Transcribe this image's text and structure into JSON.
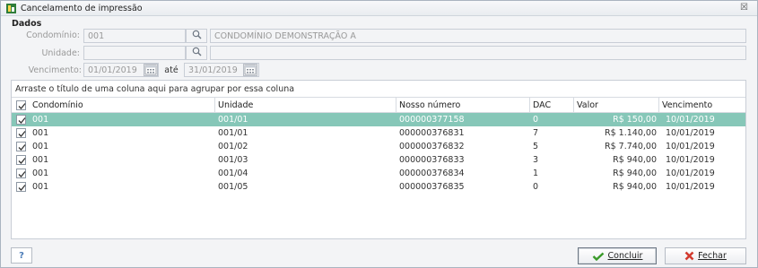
{
  "window": {
    "title": "Cancelamento de impressão",
    "close": "☒"
  },
  "dados": {
    "group_title": "Dados",
    "condominio_label": "Condomínio:",
    "condominio_code": "001",
    "condominio_name": "CONDOMÍNIO DEMONSTRAÇÃO A",
    "unidade_label": "Unidade:",
    "unidade_code": "",
    "unidade_name": "",
    "vencimento_label": "Vencimento:",
    "vencimento_from": "01/01/2019",
    "ate_label": "até",
    "vencimento_to": "31/01/2019"
  },
  "grid": {
    "group_hint": "Arraste o título de uma coluna aqui para agrupar por essa coluna",
    "columns": [
      "Condomínio",
      "Unidade",
      "Nosso número",
      "DAC",
      "Valor",
      "Vencimento"
    ],
    "rows": [
      {
        "checked": true,
        "condominio": "001",
        "unidade": "001/01",
        "nosso_numero": "000000377158",
        "dac": "0",
        "valor": "R$ 150,00",
        "vencimento": "10/01/2019"
      },
      {
        "checked": true,
        "condominio": "001",
        "unidade": "001/01",
        "nosso_numero": "000000376831",
        "dac": "7",
        "valor": "R$ 1.140,00",
        "vencimento": "10/01/2019"
      },
      {
        "checked": true,
        "condominio": "001",
        "unidade": "001/02",
        "nosso_numero": "000000376832",
        "dac": "5",
        "valor": "R$ 7.740,00",
        "vencimento": "10/01/2019"
      },
      {
        "checked": true,
        "condominio": "001",
        "unidade": "001/03",
        "nosso_numero": "000000376833",
        "dac": "3",
        "valor": "R$ 940,00",
        "vencimento": "10/01/2019"
      },
      {
        "checked": true,
        "condominio": "001",
        "unidade": "001/04",
        "nosso_numero": "000000376834",
        "dac": "1",
        "valor": "R$ 940,00",
        "vencimento": "10/01/2019"
      },
      {
        "checked": true,
        "condominio": "001",
        "unidade": "001/05",
        "nosso_numero": "000000376835",
        "dac": "0",
        "valor": "R$ 940,00",
        "vencimento": "10/01/2019"
      }
    ]
  },
  "footer": {
    "help": "?",
    "concluir": "Concluir",
    "fechar": "Fechar"
  },
  "colors": {
    "selected_row": "#86c7b8",
    "check_green": "#3a9a2a",
    "close_red": "#d23b2f"
  }
}
